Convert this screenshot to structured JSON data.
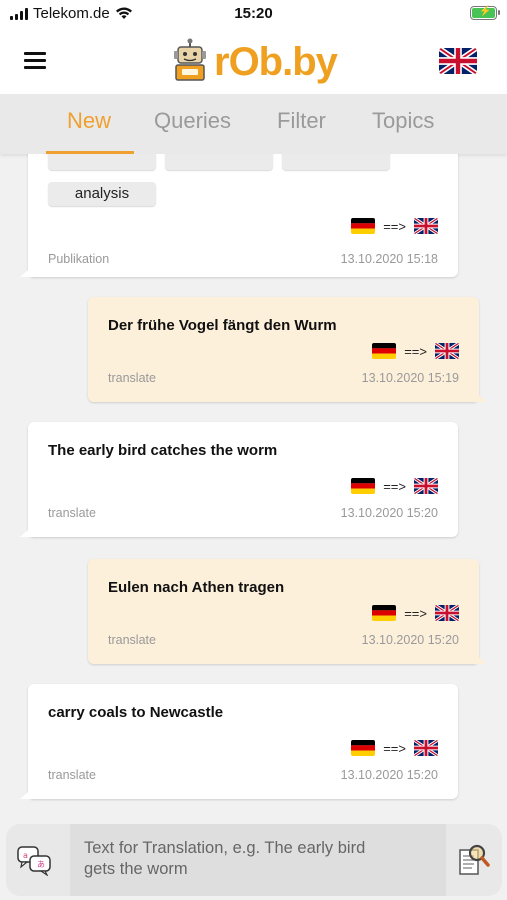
{
  "status_bar": {
    "carrier": "Telekom.de",
    "time": "15:20"
  },
  "header": {
    "logo_text": "rOb.by",
    "language_flag": "uk-flag-icon"
  },
  "tabs": [
    {
      "label": "New",
      "active": true
    },
    {
      "label": "Queries",
      "active": false
    },
    {
      "label": "Filter",
      "active": false
    },
    {
      "label": "Topics",
      "active": false
    }
  ],
  "messages": [
    {
      "side": "left",
      "tags": [
        "analysis"
      ],
      "from_flag": "german-flag-icon",
      "arrow": "==>",
      "to_flag": "uk-flag-icon",
      "type": "Publikation",
      "timestamp": "13.10.2020 15:18"
    },
    {
      "side": "right",
      "text": "Der frühe Vogel fängt den Wurm",
      "from_flag": "german-flag-icon",
      "arrow": "==>",
      "to_flag": "uk-flag-icon",
      "type": "translate",
      "timestamp": "13.10.2020 15:19"
    },
    {
      "side": "left",
      "text": "The early bird catches the worm",
      "from_flag": "german-flag-icon",
      "arrow": "==>",
      "to_flag": "uk-flag-icon",
      "type": "translate",
      "timestamp": "13.10.2020 15:20"
    },
    {
      "side": "right",
      "text": "Eulen nach Athen tragen",
      "from_flag": "german-flag-icon",
      "arrow": "==>",
      "to_flag": "uk-flag-icon",
      "type": "translate",
      "timestamp": "13.10.2020 15:20"
    },
    {
      "side": "left",
      "text": "carry coals to Newcastle",
      "from_flag": "german-flag-icon",
      "arrow": "==>",
      "to_flag": "uk-flag-icon",
      "type": "translate",
      "timestamp": "13.10.2020 15:20"
    }
  ],
  "input": {
    "placeholder_line1": "Text for Translation, e.g. The early bird",
    "placeholder_line2": "gets the worm",
    "left_icon": "chat-bubbles-icon",
    "right_icon": "search-document-icon"
  },
  "colors": {
    "accent": "#f0a030",
    "right_bubble": "#fdf0db",
    "left_bubble": "#ffffff",
    "background": "#f1f1f1"
  }
}
